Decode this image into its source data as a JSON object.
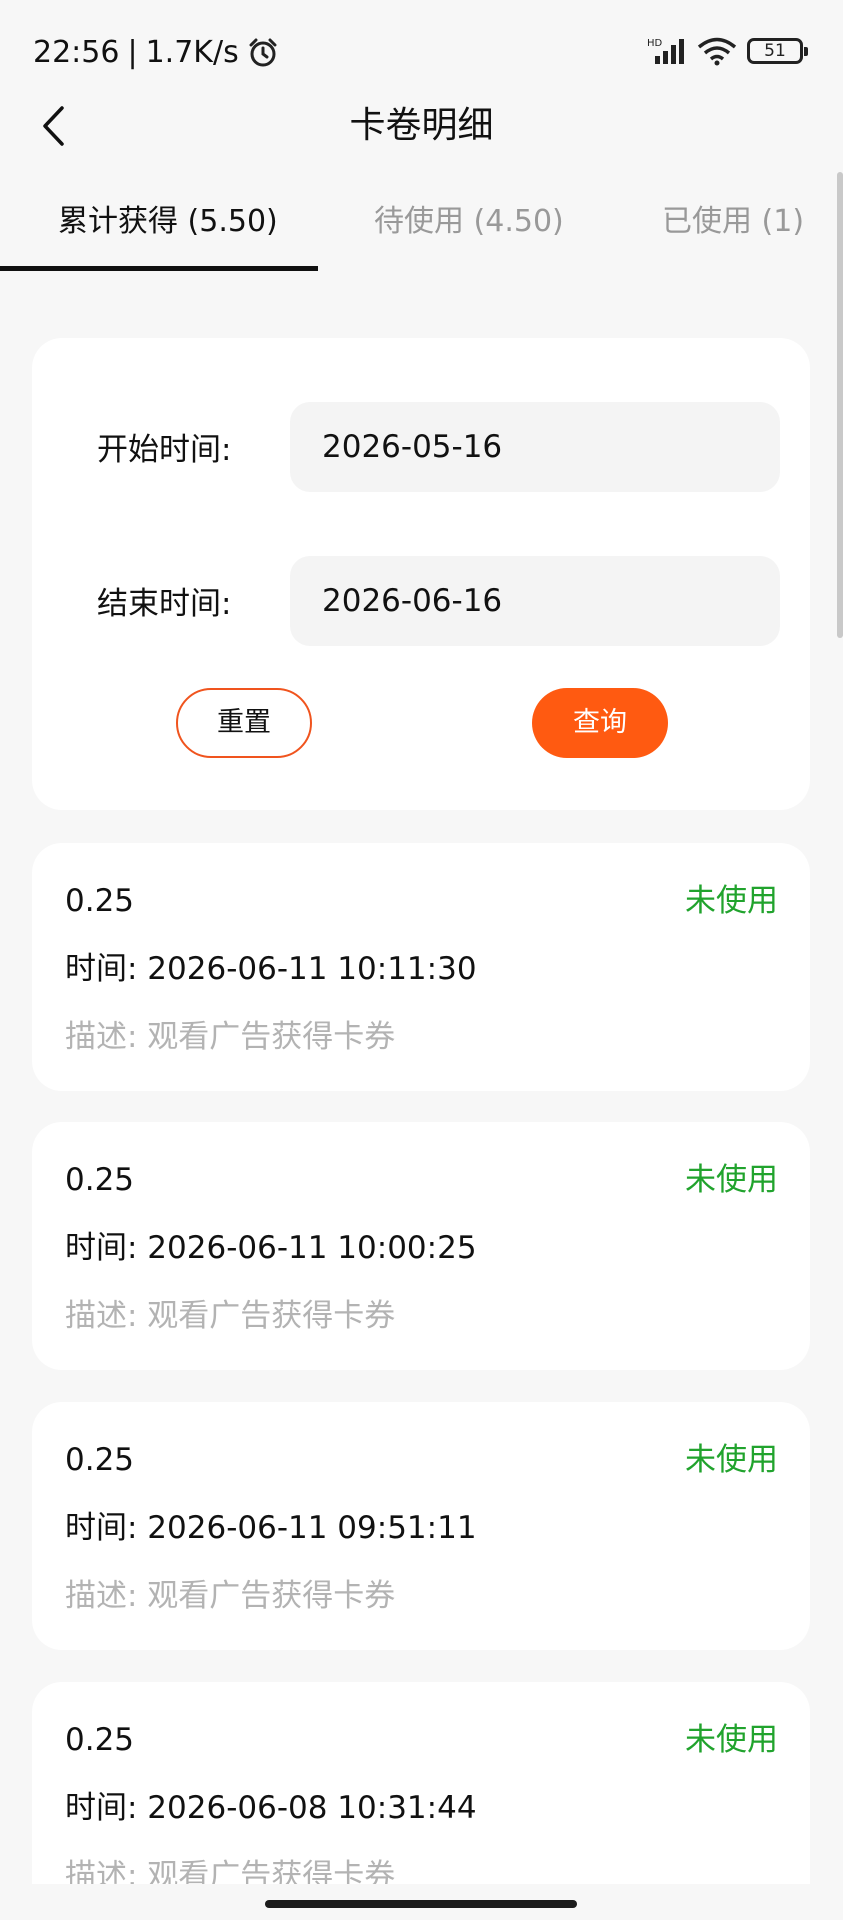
{
  "status_bar": {
    "time": "22:56",
    "separator": "|",
    "net_speed": "1.7K/s",
    "battery_level": "51",
    "icons": [
      "alarm-icon",
      "signal-icon",
      "wifi-icon",
      "battery-icon"
    ],
    "signal_label": "HD"
  },
  "header": {
    "back_icon": "chevron-left-icon",
    "title": "卡卷明细"
  },
  "tabs": [
    {
      "label": "累计获得 (5.50)",
      "active": true
    },
    {
      "label": "待使用 (4.50)",
      "active": false
    },
    {
      "label": "已使用 (1)",
      "active": false
    }
  ],
  "filter": {
    "start_label": "开始时间:",
    "start_value": "2026-05-16",
    "end_label": "结束时间:",
    "end_value": "2026-06-16",
    "reset_label": "重置",
    "query_label": "查询"
  },
  "records": [
    {
      "amount": "0.25",
      "status": "未使用",
      "time": "时间: 2026-06-11 10:11:30",
      "desc": "描述: 观看广告获得卡券"
    },
    {
      "amount": "0.25",
      "status": "未使用",
      "time": "时间: 2026-06-11 10:00:25",
      "desc": "描述: 观看广告获得卡券"
    },
    {
      "amount": "0.25",
      "status": "未使用",
      "time": "时间: 2026-06-11 09:51:11",
      "desc": "描述: 观看广告获得卡券"
    },
    {
      "amount": "0.25",
      "status": "未使用",
      "time": "时间: 2026-06-08 10:31:44",
      "desc": "描述: 观看广告获得卡券"
    }
  ],
  "colors": {
    "accent": "#ff5a11",
    "status_unused": "#21a32d",
    "muted": "#b3b3b3"
  }
}
